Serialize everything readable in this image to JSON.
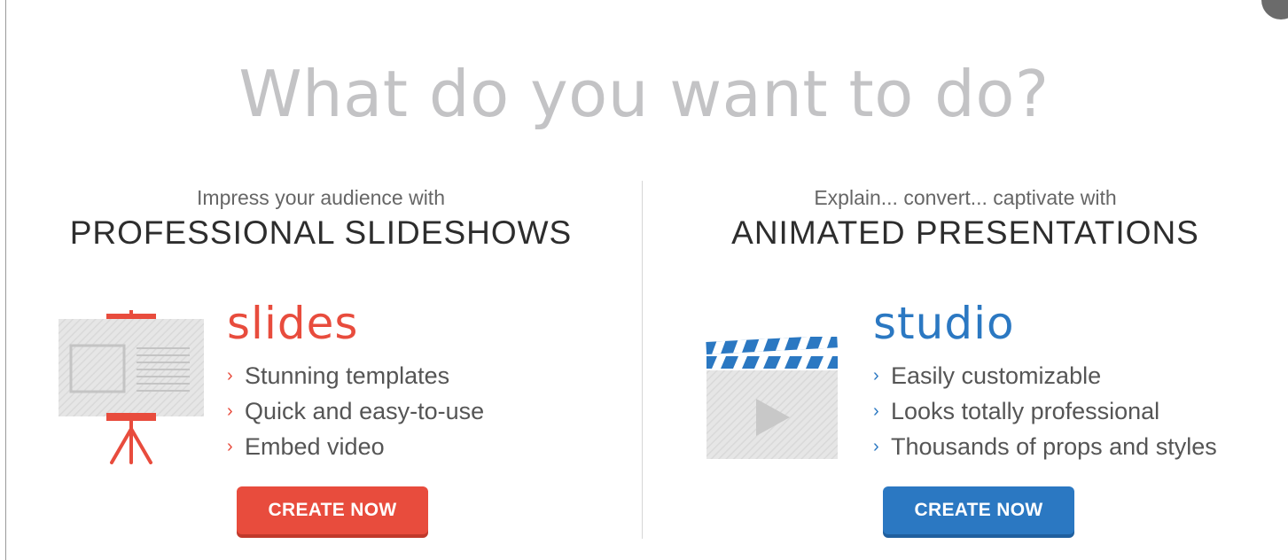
{
  "headline": "What do you want to do?",
  "left": {
    "intro": "Impress your audience with",
    "title": "PROFESSIONAL SLIDESHOWS",
    "brand": "slides",
    "features": [
      "Stunning templates",
      "Quick and easy-to-use",
      "Embed video"
    ],
    "cta": "CREATE NOW",
    "icon": "presentation-easel-icon"
  },
  "right": {
    "intro": "Explain... convert... captivate with",
    "title": "ANIMATED PRESENTATIONS",
    "brand": "studio",
    "features": [
      "Easily customizable",
      "Looks totally professional",
      "Thousands of props and styles"
    ],
    "cta": "CREATE NOW",
    "icon": "video-clapperboard-icon"
  },
  "colors": {
    "slides_accent": "#e84c3d",
    "studio_accent": "#2b78c2",
    "headline": "#c3c3c5"
  },
  "chevron": "›"
}
